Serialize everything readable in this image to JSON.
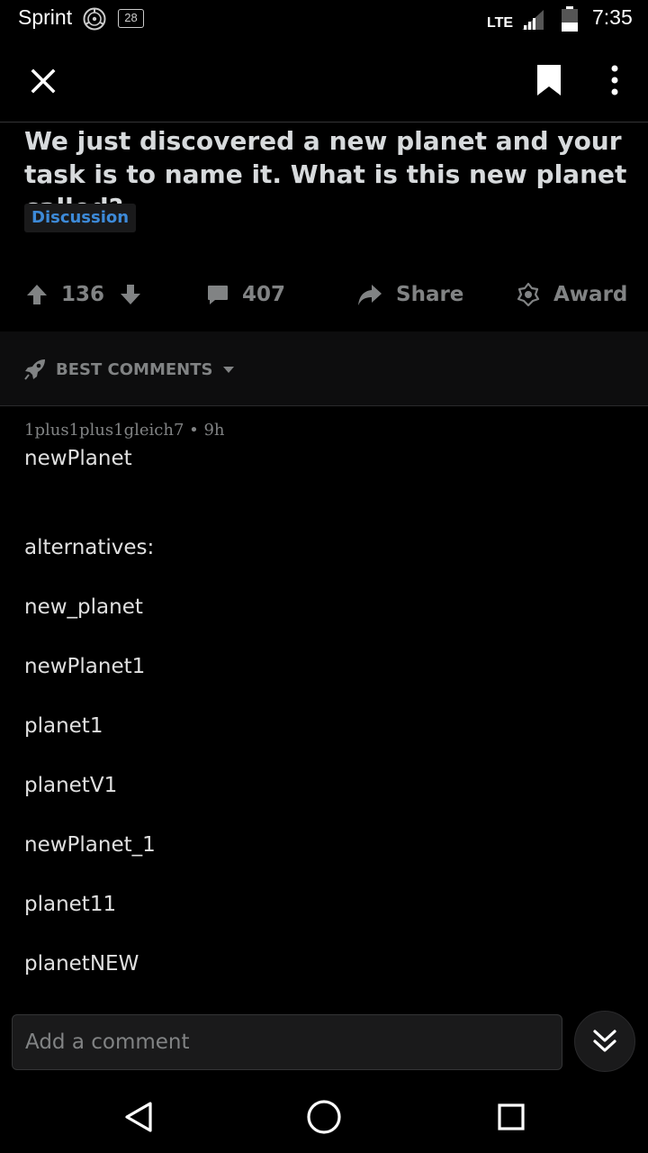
{
  "status_bar": {
    "carrier": "Sprint",
    "badge": "28",
    "network": "LTE",
    "time": "7:35"
  },
  "icons": {
    "close": "close-icon",
    "bookmark": "bookmark-icon",
    "more": "more-vertical-icon",
    "upvote": "upvote-arrow-icon",
    "downvote": "downvote-arrow-icon",
    "comment": "comment-bubble-icon",
    "share": "share-arrow-icon",
    "award": "award-icon",
    "sort": "rocket-icon",
    "jump": "double-chevron-down-icon"
  },
  "post": {
    "title": "We just discovered a new planet and your task is to name it. What is this new planet called?",
    "flair": "Discussion",
    "score": "136",
    "comment_count": "407",
    "share_label": "Share",
    "award_label": "Award"
  },
  "sort": {
    "label": "BEST COMMENTS"
  },
  "comment": {
    "author": "1plus1plus1gleich7",
    "age": "9h",
    "meta": "1plus1plus1gleich7 • 9h",
    "lines": [
      "newPlanet",
      "alternatives:",
      "new_planet",
      "newPlanet1",
      "planet1",
      "planetV1",
      "newPlanet_1",
      "planet11",
      "planetNEW"
    ]
  },
  "composer": {
    "placeholder": "Add a comment"
  },
  "colors": {
    "background": "#000000",
    "text": "#d7dadc",
    "muted": "#818384",
    "flair": "#3d8ad8"
  }
}
